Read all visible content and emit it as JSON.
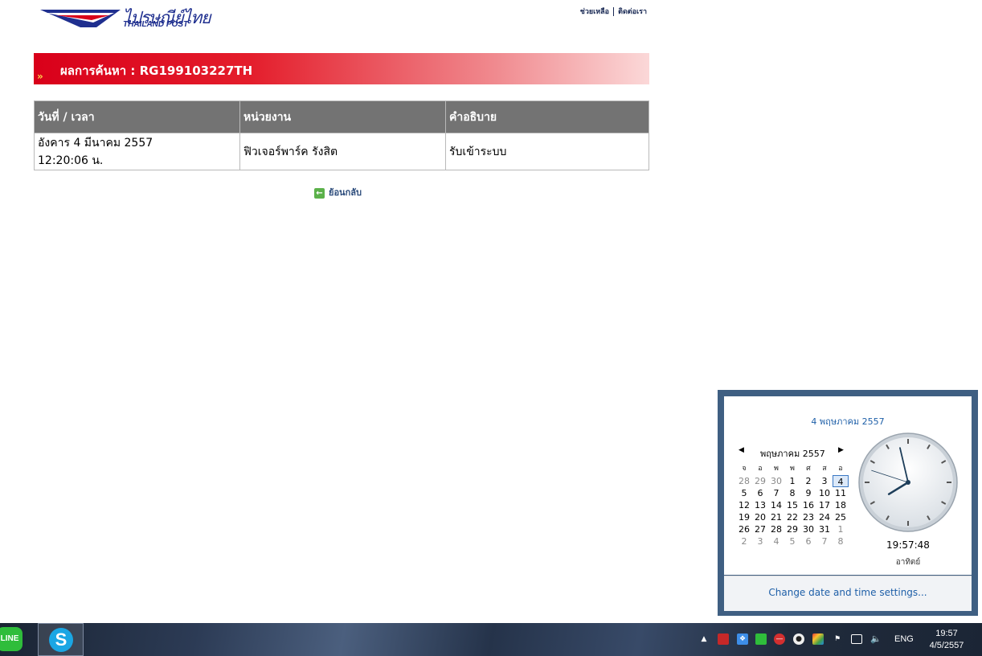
{
  "header": {
    "logo_th": "ไปรษณีย์ไทย",
    "logo_en": "THAILAND POST",
    "links": [
      "ช่วยเหลือ",
      "ติดต่อเรา"
    ]
  },
  "result": {
    "title": "ผลการค้นหา : RG199103227TH"
  },
  "table": {
    "headers": [
      "วันที่ / เวลา",
      "หน่วยงาน",
      "คำอธิบาย"
    ],
    "rows": [
      {
        "date": "อังคาร 4 มีนาคม 2557",
        "time": "12:20:06 น.",
        "office": "ฟิวเจอร์พาร์ค รังสิต",
        "description": "รับเข้าระบบ"
      }
    ]
  },
  "back_label": "ย้อนกลับ",
  "calendar": {
    "full_date": "4 พฤษภาคม 2557",
    "month_label": "พฤษภาคม 2557",
    "weekdays": [
      "จ",
      "อ",
      "พ",
      "พ",
      "ศ",
      "ส",
      "อ"
    ],
    "weeks": [
      [
        "28",
        "29",
        "30",
        "1",
        "2",
        "3",
        "4"
      ],
      [
        "5",
        "6",
        "7",
        "8",
        "9",
        "10",
        "11"
      ],
      [
        "12",
        "13",
        "14",
        "15",
        "16",
        "17",
        "18"
      ],
      [
        "19",
        "20",
        "21",
        "22",
        "23",
        "24",
        "25"
      ],
      [
        "26",
        "27",
        "28",
        "29",
        "30",
        "31",
        "1"
      ],
      [
        "2",
        "3",
        "4",
        "5",
        "6",
        "7",
        "8"
      ]
    ],
    "today": "4",
    "clock_time": "19:57:48",
    "clock_day": "อาทิตย์",
    "change_link": "Change date and time settings..."
  },
  "taskbar": {
    "apps": [
      {
        "name": "LINE",
        "icon": "line-icon"
      },
      {
        "name": "S",
        "icon": "skype-icon"
      }
    ],
    "language": "ENG",
    "time": "19:57",
    "date": "4/5/2557"
  },
  "colors": {
    "banner_start": "#d9001a",
    "table_header": "#737373",
    "link_blue": "#1e5fa8"
  }
}
